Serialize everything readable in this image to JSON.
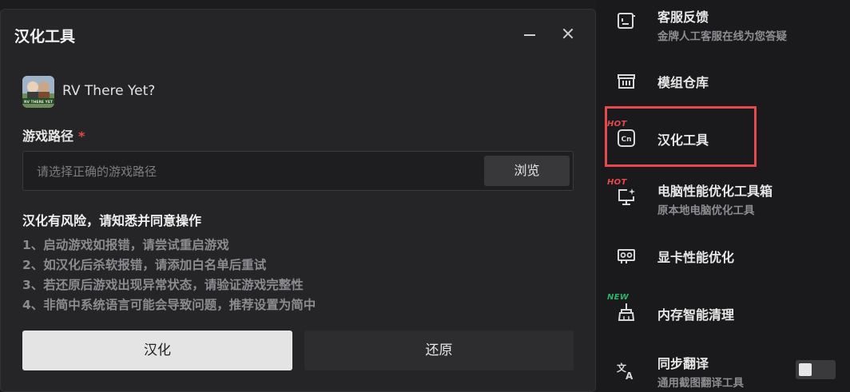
{
  "dialog": {
    "title": "汉化工具",
    "game": {
      "name": "RV There Yet?",
      "thumb_label": "RV THERE YET"
    },
    "path": {
      "label": "游戏路径",
      "required_mark": "*",
      "placeholder": "请选择正确的游戏路径",
      "value": "",
      "browse_label": "浏览"
    },
    "risk": {
      "title": "汉化有风险，请知悉并同意操作",
      "tips": [
        "1、启动游戏如报错，请尝试重启游戏",
        "2、如汉化后杀软报错，请添加白名单后重试",
        "3、若还原后游戏出现异常状态，请验证游戏完整性",
        "4、非简中系统语言可能会导致问题，推荐设置为简中"
      ]
    },
    "apply_label": "汉化",
    "restore_label": "还原"
  },
  "sidebar": {
    "items": [
      {
        "title": "客服反馈",
        "subtitle": "金牌人工客服在线为您答疑",
        "tag": "",
        "icon": "support-icon"
      },
      {
        "title": "模组仓库",
        "subtitle": "",
        "tag": "",
        "icon": "store-icon"
      },
      {
        "title": "汉化工具",
        "subtitle": "",
        "tag": "HOT",
        "icon": "cn-icon"
      },
      {
        "title": "电脑性能优化工具箱",
        "subtitle": "原本地电脑优化工具",
        "tag": "HOT",
        "icon": "monitor-sparkle-icon"
      },
      {
        "title": "显卡性能优化",
        "subtitle": "",
        "tag": "",
        "icon": "gpu-icon"
      },
      {
        "title": "内存智能清理",
        "subtitle": "",
        "tag": "NEW",
        "icon": "broom-icon"
      },
      {
        "title": "同步翻译",
        "subtitle": "通用截图翻译工具",
        "tag": "",
        "icon": "translate-icon"
      }
    ],
    "translate_toggle_on": false
  },
  "colors": {
    "accent_red": "#e5484d",
    "new_green": "#2fb36a",
    "bg": "#1c1c1e",
    "panel": "#252527"
  }
}
